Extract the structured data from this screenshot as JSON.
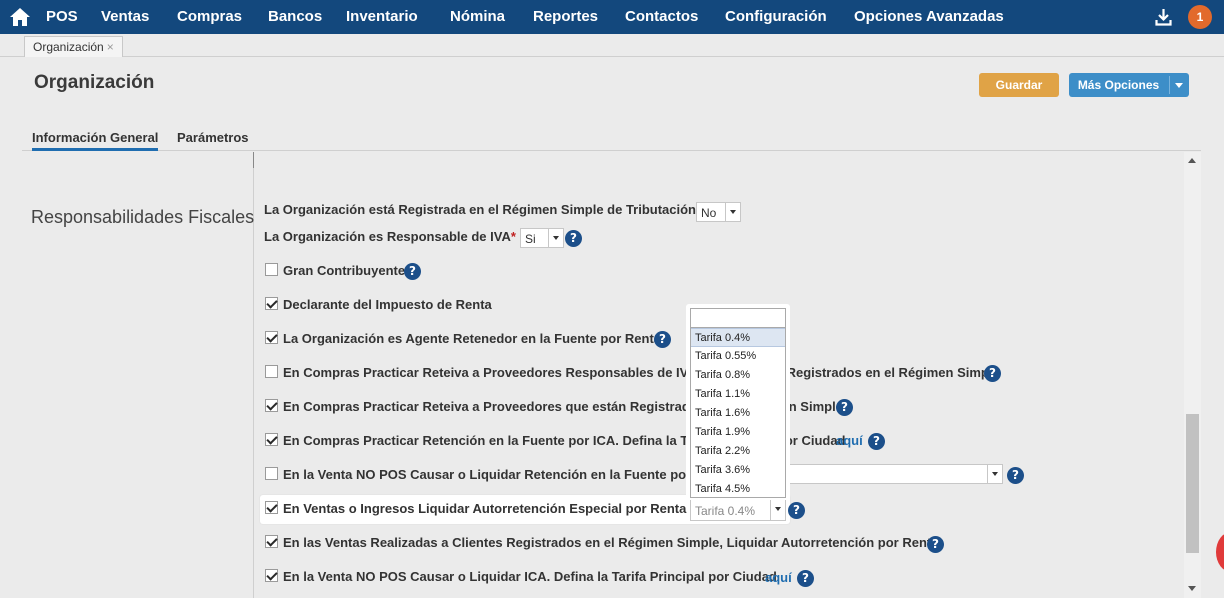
{
  "nav": {
    "items": [
      "POS",
      "Ventas",
      "Compras",
      "Bancos",
      "Inventario",
      "Nómina",
      "Reportes",
      "Contactos",
      "Configuración",
      "Opciones Avanzadas"
    ],
    "notifications": "1"
  },
  "doc_tab": {
    "label": "Organización",
    "close": "×"
  },
  "page": {
    "title": "Organización"
  },
  "actions": {
    "save": "Guardar",
    "more": "Más Opciones"
  },
  "subtabs": [
    "Información General",
    "Parámetros"
  ],
  "section": {
    "title": "Responsabilidades Fiscales"
  },
  "fields": {
    "regimen_simple": {
      "label": "La Organización está Registrada en el Régimen Simple de Tributación",
      "value": "No"
    },
    "responsable_iva": {
      "label": "La Organización es Responsable de IVA",
      "required": "*",
      "value": "Si"
    }
  },
  "rows": [
    {
      "label": "Gran Contribuyente",
      "checked": false
    },
    {
      "label": "Declarante del Impuesto de Renta",
      "checked": true
    },
    {
      "label": "La Organización es Agente Retenedor en la Fuente por Renta",
      "checked": true
    },
    {
      "label": "En Compras Practicar Reteiva a Proveedores Responsables de IVA que No Estén Registrados en el Régimen Simple",
      "checked": false
    },
    {
      "label": "En Compras Practicar Reteiva a Proveedores que están Registrados en el Régimen Simple",
      "checked": true
    },
    {
      "label": "En Compras Practicar Retención en la Fuente por ICA. Defina la Tarifa Principal por Ciudad",
      "checked": true,
      "link": "aquí"
    },
    {
      "label": "En la Venta NO POS Causar o Liquidar Retención en la Fuente por Renta",
      "checked": false
    },
    {
      "label": "En Ventas o Ingresos Liquidar Autorretención Especial por Renta",
      "checked": true,
      "select_value": "Tarifa 0.4%"
    },
    {
      "label": "En las Ventas Realizadas a Clientes Registrados en el Régimen Simple, Liquidar Autorretención por Renta",
      "checked": true
    },
    {
      "label": "En la Venta NO POS Causar o Liquidar ICA. Defina la Tarifa Principal por Ciudad",
      "checked": true,
      "link": "aquí"
    }
  ],
  "dropdown": {
    "search_value": "",
    "options": [
      "Tarifa 0.4%",
      "Tarifa 0.55%",
      "Tarifa 0.8%",
      "Tarifa 1.1%",
      "Tarifa 1.6%",
      "Tarifa 1.9%",
      "Tarifa 2.2%",
      "Tarifa 3.6%",
      "Tarifa 4.5%"
    ],
    "selected": "Tarifa 0.4%"
  },
  "colors": {
    "nav_bg": "#13487d",
    "save": "#e0a346",
    "more": "#3d8ec8",
    "link": "#1f6db0",
    "help": "#1c4f8a"
  }
}
